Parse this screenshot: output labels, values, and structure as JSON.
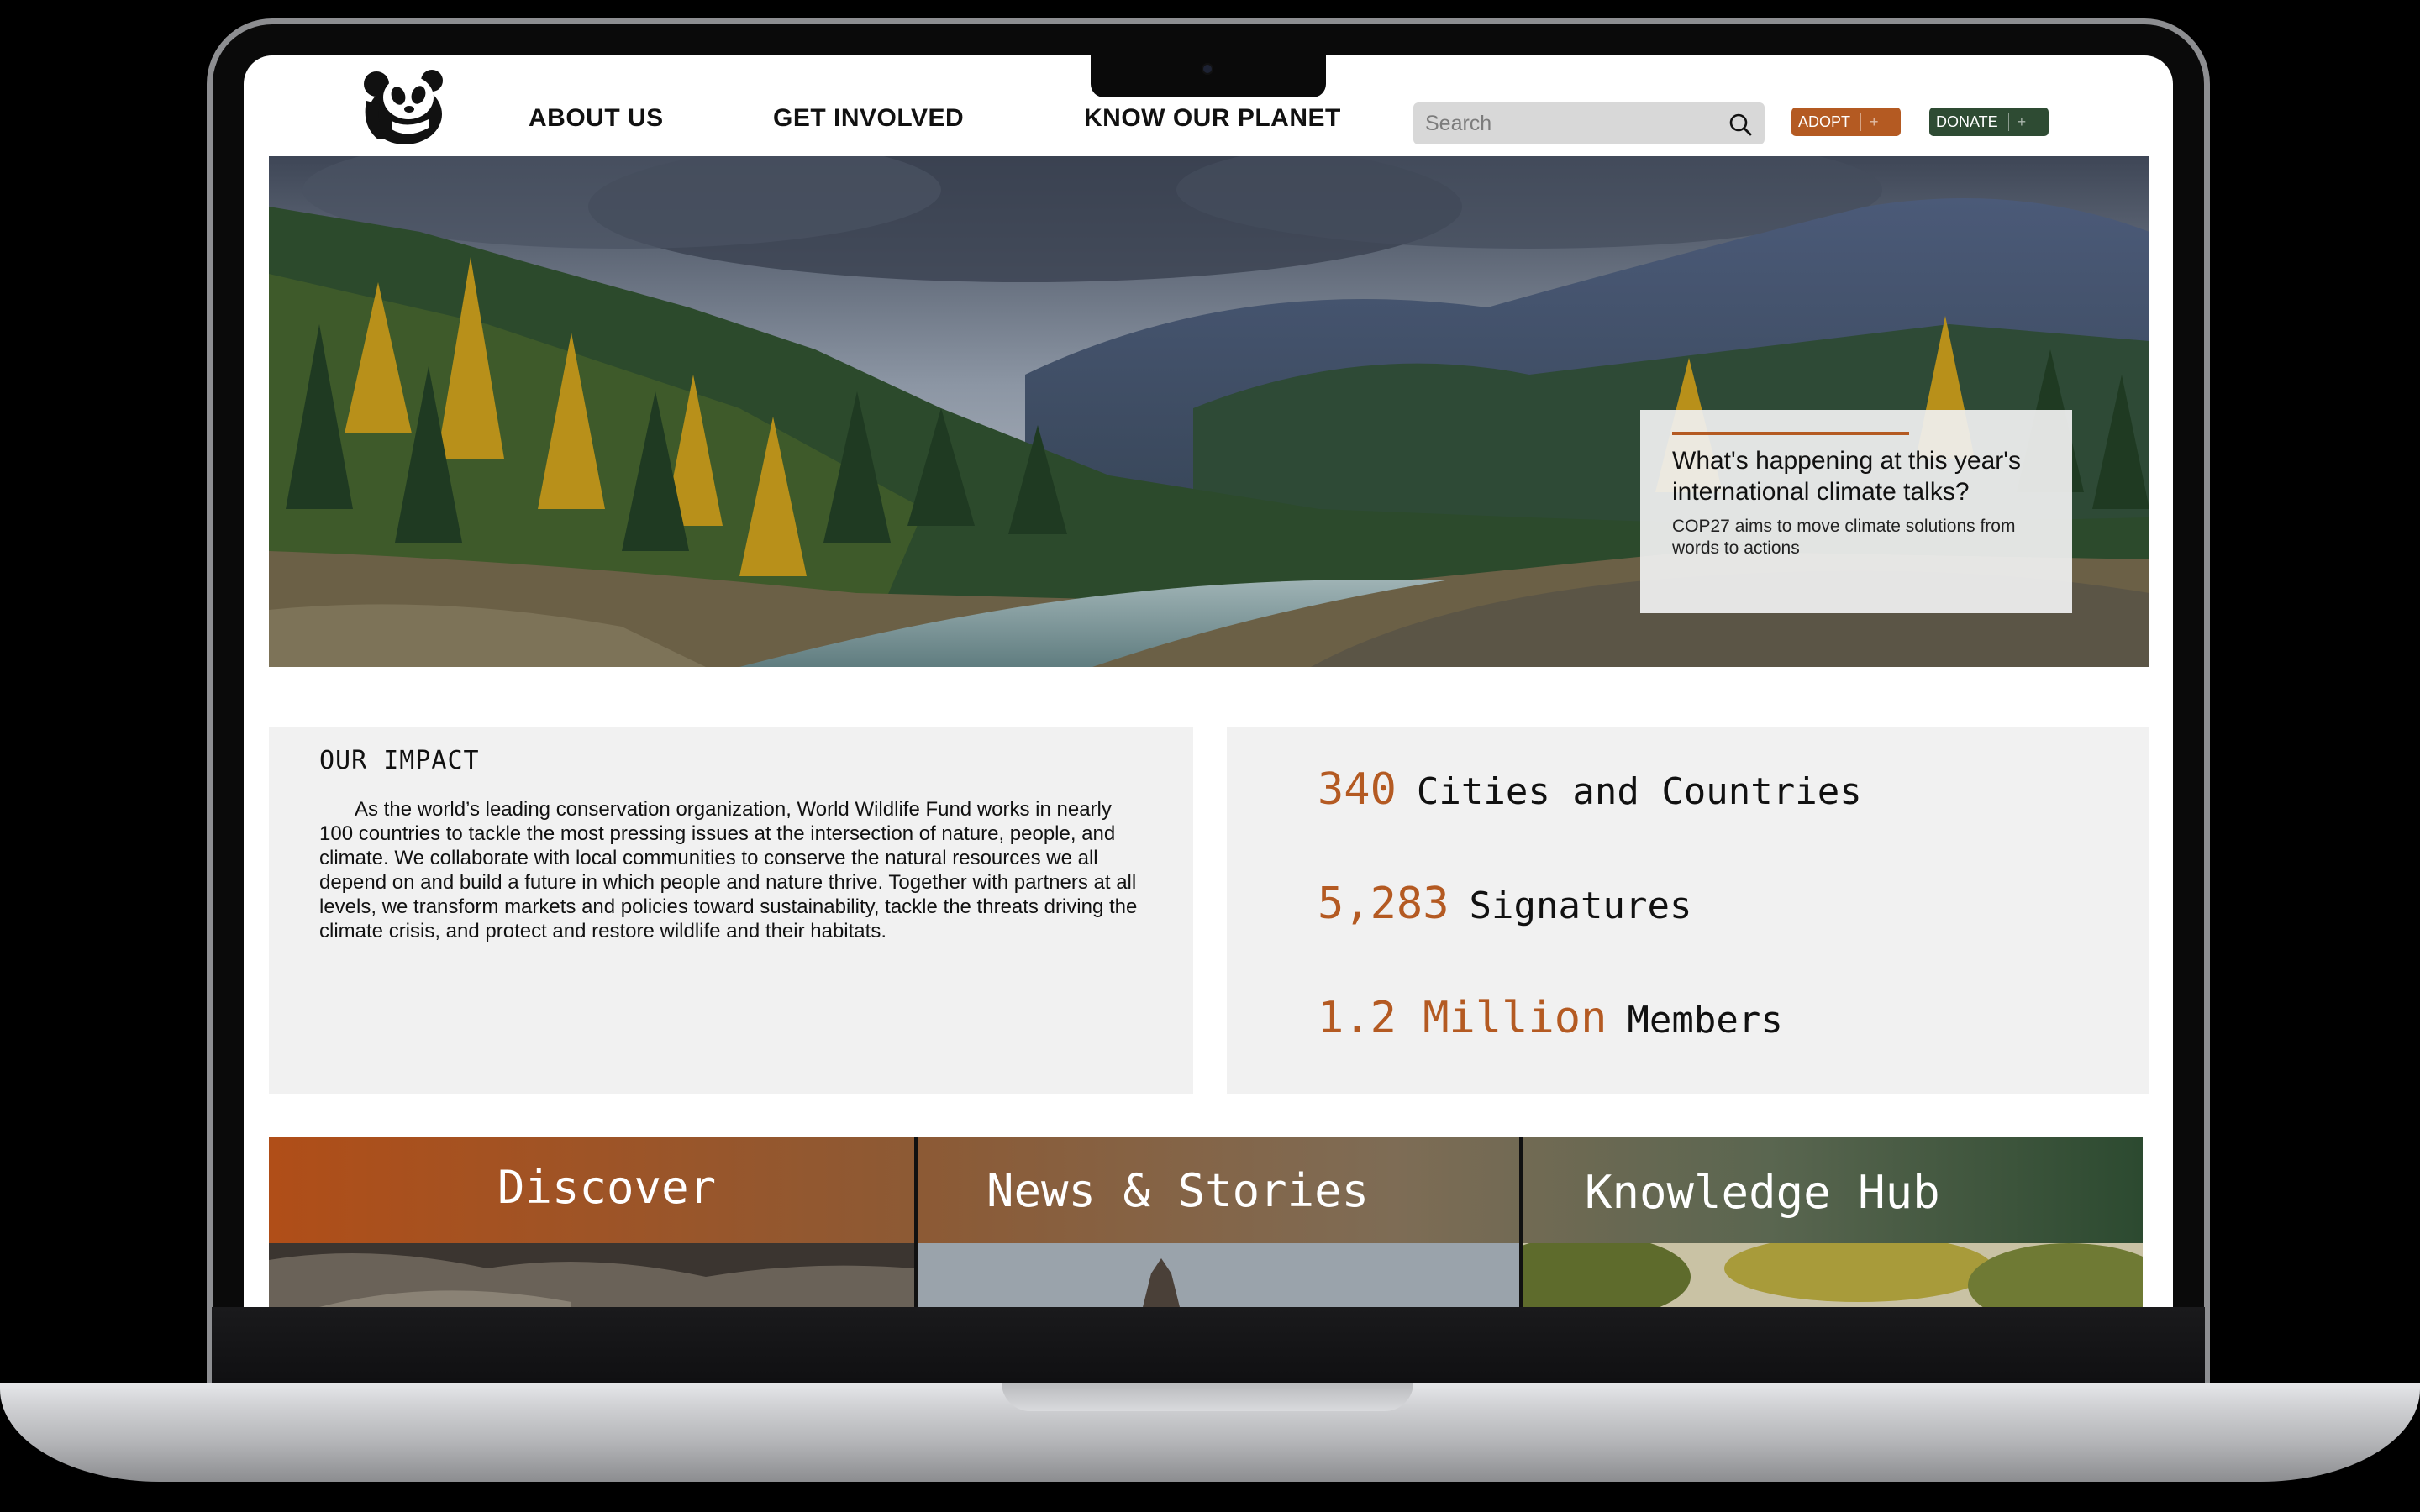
{
  "header": {
    "nav": [
      "ABOUT US",
      "GET INVOLVED",
      "KNOW OUR PLANET"
    ],
    "search_placeholder": "Search",
    "adopt_label": "ADOPT",
    "donate_label": "DONATE",
    "plus_symbol": "+"
  },
  "hero": {
    "headline": "What's happening at this year's international climate talks?",
    "subtext": "COP27 aims to move climate solutions from words to actions"
  },
  "impact": {
    "title": "OUR IMPACT",
    "body": "As the world’s leading conservation organization, World Wildlife Fund works in nearly 100 countries to tackle the most pressing issues at the intersection of nature, people, and climate. We collaborate with local communities to conserve the natural resources we all depend on and build a future in which people and nature thrive. Together with partners at all levels, we transform markets and policies toward sustainability, tackle the threats driving the climate crisis, and protect and restore wildlife and their habitats."
  },
  "stats": [
    {
      "number": "340",
      "label": "Cities and Countries"
    },
    {
      "number": "5,283",
      "label": "Signatures"
    },
    {
      "number": "1.2 Million",
      "label": "Members"
    }
  ],
  "cards": [
    {
      "title": "Discover"
    },
    {
      "title": "News & Stories"
    },
    {
      "title": "Knowledge Hub"
    }
  ],
  "colors": {
    "accent_orange": "#b45a22",
    "accent_green": "#2e4b33",
    "panel_bg": "#f1f1f1"
  },
  "icons": [
    "panda-logo-icon",
    "search-icon",
    "plus-icon"
  ]
}
